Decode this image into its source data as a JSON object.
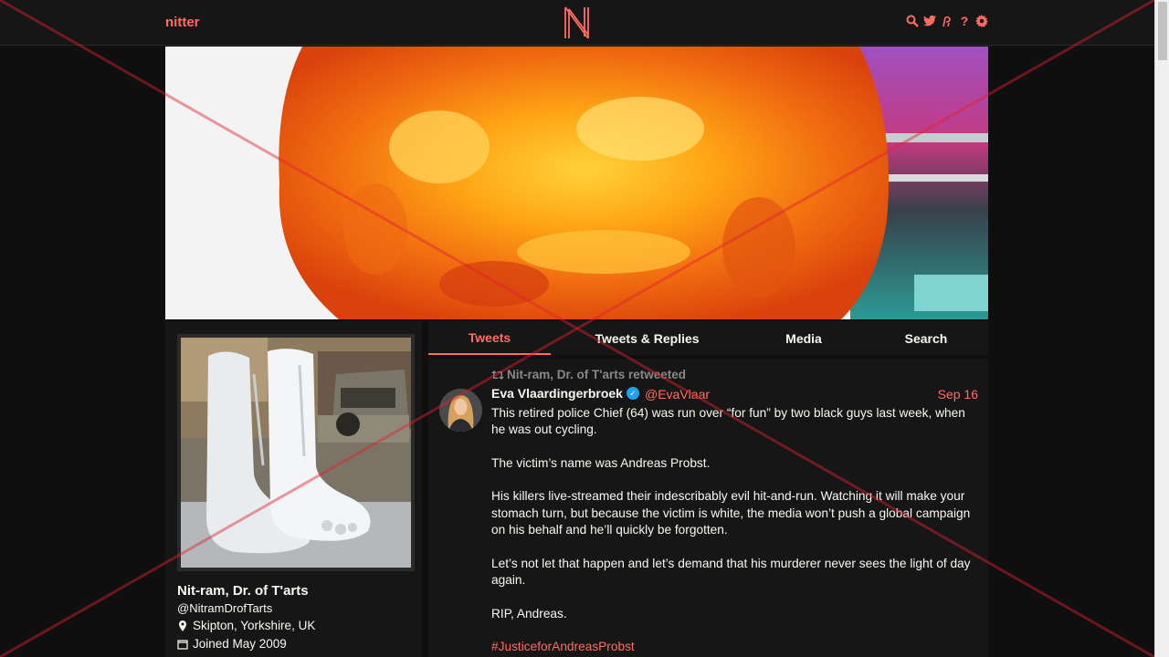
{
  "navbar": {
    "brand": "nitter",
    "logo_letter": "N",
    "icons": [
      "search-icon",
      "twitter-bird-icon",
      "rss-icon",
      "help-icon",
      "gear-icon"
    ],
    "help_glyph": "?"
  },
  "colors": {
    "accent": "#ff6c60",
    "background": "#0f0f0f",
    "panel": "#161616",
    "text": "#f8f8f2",
    "muted": "#888889"
  },
  "profile": {
    "fullname": "Nit-ram, Dr. of T'arts",
    "username": "@NitramDrofTarts",
    "location": "Skipton, Yorkshire, UK",
    "joined": "Joined May 2009"
  },
  "tabs": [
    {
      "label": "Tweets",
      "active": true
    },
    {
      "label": "Tweets & Replies",
      "active": false
    },
    {
      "label": "Media",
      "active": false
    },
    {
      "label": "Search",
      "active": false
    }
  ],
  "timeline": {
    "retweet_header": "Nit-ram, Dr. of T'arts retweeted",
    "tweet": {
      "fullname": "Eva Vlaardingerbroek",
      "verified": true,
      "username": "@EvaVlaar",
      "date": "Sep 16",
      "paragraphs": [
        "This retired police Chief (64) was run over “for fun” by two black guys last week, when he was out cycling.",
        "The victim’s name was Andreas Probst.",
        "His killers live-streamed their indescribably evil hit-and-run. Watching it will make your stomach turn, but because the victim is white, the media won’t push a global campaign on his behalf and he’ll quickly be forgotten.",
        "Let’s not let that happen and let’s demand that his murderer never sees the light of day again.",
        "RIP, Andreas."
      ],
      "hashtag": "#JusticeforAndreasProbst"
    }
  }
}
